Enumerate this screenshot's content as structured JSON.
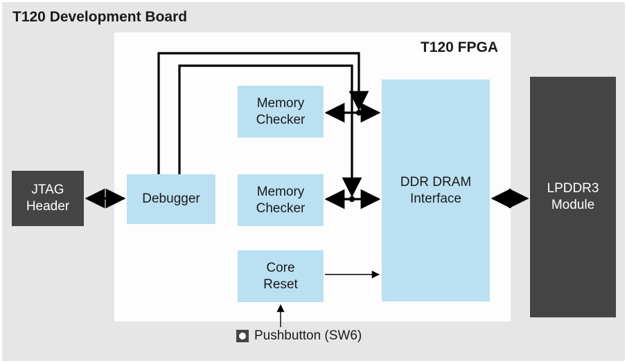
{
  "board": {
    "title": "T120 Development Board"
  },
  "fpga": {
    "title": "T120 FPGA",
    "blocks": {
      "debugger": "Debugger",
      "memory_checker_1": "Memory\nChecker",
      "memory_checker_2": "Memory\nChecker",
      "core_reset": "Core\nReset",
      "ddr_interface": "DDR DRAM\nInterface"
    }
  },
  "external": {
    "jtag_header": "JTAG\nHeader",
    "lpddr3_module": "LPDDR3\nModule"
  },
  "pushbutton": {
    "label": "Pushbutton (SW6)"
  },
  "connections": [
    {
      "from": "jtag_header",
      "to": "debugger",
      "type": "bidirectional_thick"
    },
    {
      "from": "debugger",
      "to": "memory_checker_1_bus",
      "type": "routed_thick"
    },
    {
      "from": "debugger",
      "to": "memory_checker_2_bus",
      "type": "routed_thick"
    },
    {
      "from": "memory_checker_1",
      "to": "ddr_interface",
      "type": "bidirectional_thick"
    },
    {
      "from": "memory_checker_2",
      "to": "ddr_interface",
      "type": "bidirectional_thick"
    },
    {
      "from": "core_reset",
      "to": "ddr_interface",
      "type": "unidirectional_thin"
    },
    {
      "from": "ddr_interface",
      "to": "lpddr3_module",
      "type": "bidirectional_thick"
    },
    {
      "from": "pushbutton",
      "to": "core_reset",
      "type": "unidirectional_thin"
    }
  ]
}
